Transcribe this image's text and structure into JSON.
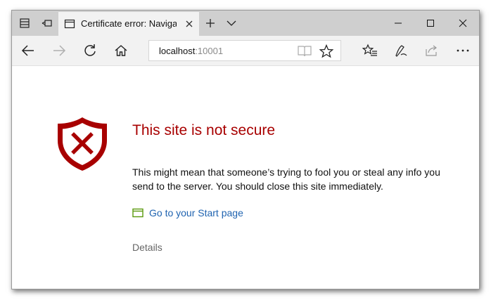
{
  "tab": {
    "title": "Certificate error: Naviga"
  },
  "address_bar": {
    "host": "localhost",
    "port": ":10001"
  },
  "error": {
    "title": "This site is not secure",
    "description": "This might mean that someone’s trying to fool you or steal any info you send to the server. You should close this site immediately.",
    "start_link": "Go to your Start page",
    "details": "Details"
  },
  "colors": {
    "error_red": "#a80000",
    "link_blue": "#1f63b0",
    "tab_bar": "#cfcfcf",
    "toolbar": "#f2f2f2"
  },
  "icons": [
    "tabs-aside-icon",
    "tab-preview-icon",
    "page-icon",
    "close-icon",
    "new-tab-plus-icon",
    "chevron-down-icon",
    "minimize-icon",
    "maximize-icon",
    "back-arrow-icon",
    "forward-arrow-icon",
    "refresh-icon",
    "home-icon",
    "reading-view-icon",
    "favorite-star-icon",
    "favorites-hub-icon",
    "web-note-pen-icon",
    "share-icon",
    "more-dots-icon",
    "shield-error-icon",
    "start-page-icon"
  ]
}
